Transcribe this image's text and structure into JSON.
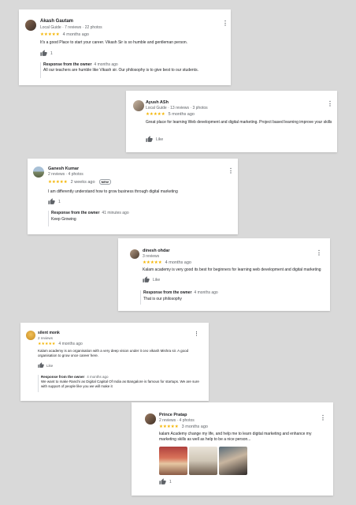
{
  "reviews": [
    {
      "name": "Akash Gautam",
      "meta": "Local Guide · 7 reviews · 22 photos",
      "stars": "★★★★★",
      "rating": 5,
      "time": "4 months ago",
      "text": "It's a good Place to start your career. Vikash Sir is so humble and gentleman person.",
      "likes": "1",
      "response_title": "Response from the owner",
      "response_time": "4 months ago",
      "response_text": "All our teachers are humble like Vikash sir. Our philosophy is to give best to our students."
    },
    {
      "name": "Ayush ASh",
      "meta": "Local Guide · 13 reviews · 3 photos",
      "stars": "★★★★★",
      "rating": 4.5,
      "time": "5 months ago",
      "text": "Great place for learning Web development and digital marketing. Project based learning improve your skills",
      "likes": "Like"
    },
    {
      "name": "Ganesh Kumar",
      "meta": "2 reviews · 4 photos",
      "stars": "★★★★★",
      "rating": 5,
      "time": "2 weeks ago",
      "badge": "NEW",
      "text": "I am differently understand how to grow business through digital marketing",
      "likes": "1",
      "response_title": "Response from the owner",
      "response_time": "41 minutes ago",
      "response_text": "Keep Growing"
    },
    {
      "name": "dinesh ohdar",
      "meta": "3 reviews",
      "stars": "★★★★★",
      "rating": 5,
      "time": "4 months ago",
      "text": "Kalam academy is very good its best for beginners for learning web development and digital marketing",
      "likes": "Like",
      "response_title": "Response from the owner",
      "response_time": "4 months ago",
      "response_text": "That is our philosophy"
    },
    {
      "name": "silent monk",
      "meta": "2 reviews",
      "stars": "★★★★★",
      "rating": 5,
      "time": "4 months ago",
      "text": "Kalam academy is an organisation with a very deep vision under it ceo vikash Mishra sir. A good organisation to grow once career here.",
      "likes": "Like",
      "response_title": "Response from the owner",
      "response_time": "4 months ago",
      "response_text": "We want to make Ranchi as Digital Capital Of India as Bangalore is famous for startups. We are sure with support of people like you we will make it"
    },
    {
      "name": "Prince Pratap",
      "meta": "2 reviews · 4 photos",
      "stars": "★★★★★",
      "rating": 5,
      "time": "3 months ago",
      "text": "kalam Academy change my life, and help me to learn digital marketing and enhance my marketing skills as well as help to be a nice person...",
      "likes": "1"
    }
  ],
  "icons": {
    "more": "more-vert-icon",
    "thumb": "thumbs-up-icon"
  },
  "colors": {
    "star": "#f4b400",
    "background": "#d9d9d9"
  }
}
